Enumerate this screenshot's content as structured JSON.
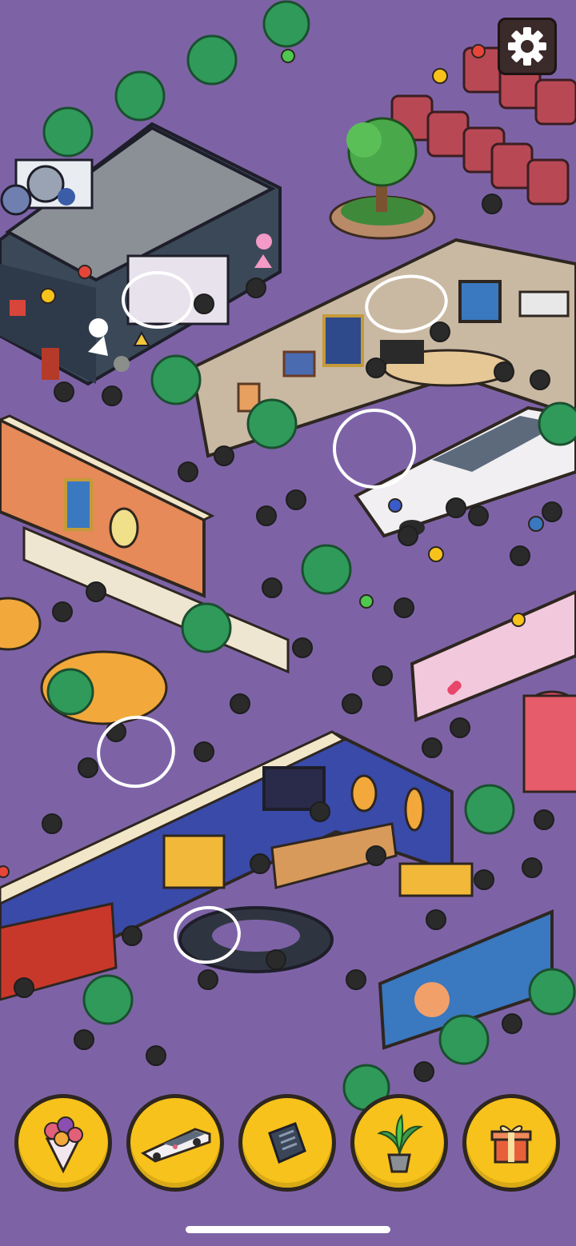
{
  "game": {
    "settings": {
      "icon": "gear-icon"
    },
    "items": [
      {
        "icon": "flower-bouquet-icon"
      },
      {
        "icon": "limousine-icon"
      },
      {
        "icon": "wallet-icon"
      },
      {
        "icon": "potted-plant-icon"
      },
      {
        "icon": "gift-box-icon"
      }
    ],
    "found_markers": 5,
    "colors": {
      "background": "#7d63a6",
      "button": "#f7c21b",
      "outline": "#2e2620",
      "marker": "#ffffff"
    }
  }
}
